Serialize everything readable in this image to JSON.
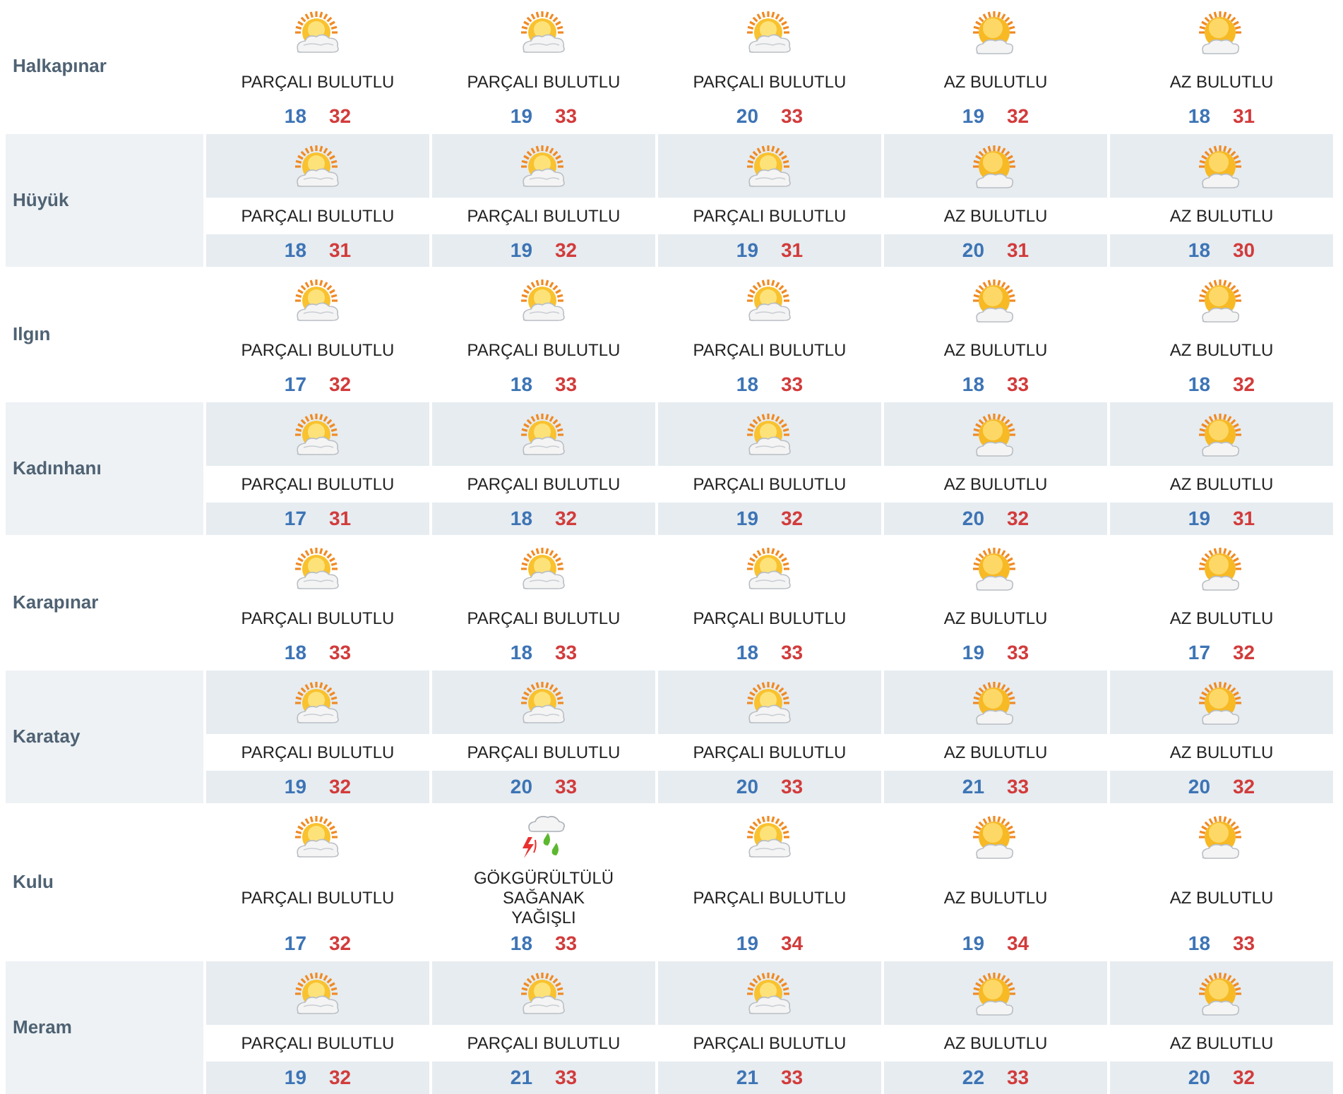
{
  "rows": [
    {
      "name": "Halkapınar",
      "forecasts": [
        {
          "kind": "partly_cloudy",
          "condition": "PARÇALI BULUTLU",
          "low": "18",
          "high": "32"
        },
        {
          "kind": "partly_cloudy",
          "condition": "PARÇALI BULUTLU",
          "low": "19",
          "high": "33"
        },
        {
          "kind": "partly_cloudy",
          "condition": "PARÇALI BULUTLU",
          "low": "20",
          "high": "33"
        },
        {
          "kind": "mostly_sunny",
          "condition": "AZ BULUTLU",
          "low": "19",
          "high": "32"
        },
        {
          "kind": "mostly_sunny",
          "condition": "AZ BULUTLU",
          "low": "18",
          "high": "31"
        }
      ]
    },
    {
      "name": "Hüyük",
      "forecasts": [
        {
          "kind": "partly_cloudy",
          "condition": "PARÇALI BULUTLU",
          "low": "18",
          "high": "31"
        },
        {
          "kind": "partly_cloudy",
          "condition": "PARÇALI BULUTLU",
          "low": "19",
          "high": "32"
        },
        {
          "kind": "partly_cloudy",
          "condition": "PARÇALI BULUTLU",
          "low": "19",
          "high": "31"
        },
        {
          "kind": "mostly_sunny",
          "condition": "AZ BULUTLU",
          "low": "20",
          "high": "31"
        },
        {
          "kind": "mostly_sunny",
          "condition": "AZ BULUTLU",
          "low": "18",
          "high": "30"
        }
      ]
    },
    {
      "name": "Ilgın",
      "forecasts": [
        {
          "kind": "partly_cloudy",
          "condition": "PARÇALI BULUTLU",
          "low": "17",
          "high": "32"
        },
        {
          "kind": "partly_cloudy",
          "condition": "PARÇALI BULUTLU",
          "low": "18",
          "high": "33"
        },
        {
          "kind": "partly_cloudy",
          "condition": "PARÇALI BULUTLU",
          "low": "18",
          "high": "33"
        },
        {
          "kind": "mostly_sunny",
          "condition": "AZ BULUTLU",
          "low": "18",
          "high": "33"
        },
        {
          "kind": "mostly_sunny",
          "condition": "AZ BULUTLU",
          "low": "18",
          "high": "32"
        }
      ]
    },
    {
      "name": "Kadınhanı",
      "forecasts": [
        {
          "kind": "partly_cloudy",
          "condition": "PARÇALI BULUTLU",
          "low": "17",
          "high": "31"
        },
        {
          "kind": "partly_cloudy",
          "condition": "PARÇALI BULUTLU",
          "low": "18",
          "high": "32"
        },
        {
          "kind": "partly_cloudy",
          "condition": "PARÇALI BULUTLU",
          "low": "19",
          "high": "32"
        },
        {
          "kind": "mostly_sunny",
          "condition": "AZ BULUTLU",
          "low": "20",
          "high": "32"
        },
        {
          "kind": "mostly_sunny",
          "condition": "AZ BULUTLU",
          "low": "19",
          "high": "31"
        }
      ]
    },
    {
      "name": "Karapınar",
      "forecasts": [
        {
          "kind": "partly_cloudy",
          "condition": "PARÇALI BULUTLU",
          "low": "18",
          "high": "33"
        },
        {
          "kind": "partly_cloudy",
          "condition": "PARÇALI BULUTLU",
          "low": "18",
          "high": "33"
        },
        {
          "kind": "partly_cloudy",
          "condition": "PARÇALI BULUTLU",
          "low": "18",
          "high": "33"
        },
        {
          "kind": "mostly_sunny",
          "condition": "AZ BULUTLU",
          "low": "19",
          "high": "33"
        },
        {
          "kind": "mostly_sunny",
          "condition": "AZ BULUTLU",
          "low": "17",
          "high": "32"
        }
      ]
    },
    {
      "name": "Karatay",
      "forecasts": [
        {
          "kind": "partly_cloudy",
          "condition": "PARÇALI BULUTLU",
          "low": "19",
          "high": "32"
        },
        {
          "kind": "partly_cloudy",
          "condition": "PARÇALI BULUTLU",
          "low": "20",
          "high": "33"
        },
        {
          "kind": "partly_cloudy",
          "condition": "PARÇALI BULUTLU",
          "low": "20",
          "high": "33"
        },
        {
          "kind": "mostly_sunny",
          "condition": "AZ BULUTLU",
          "low": "21",
          "high": "33"
        },
        {
          "kind": "mostly_sunny",
          "condition": "AZ BULUTLU",
          "low": "20",
          "high": "32"
        }
      ]
    },
    {
      "name": "Kulu",
      "forecasts": [
        {
          "kind": "partly_cloudy",
          "condition": "PARÇALI BULUTLU",
          "low": "17",
          "high": "32"
        },
        {
          "kind": "thunderstorm",
          "condition": "GÖKGÜRÜLTÜLÜ SAĞANAK YAĞIŞLI",
          "low": "18",
          "high": "33"
        },
        {
          "kind": "partly_cloudy",
          "condition": "PARÇALI BULUTLU",
          "low": "19",
          "high": "34"
        },
        {
          "kind": "mostly_sunny",
          "condition": "AZ BULUTLU",
          "low": "19",
          "high": "34"
        },
        {
          "kind": "mostly_sunny",
          "condition": "AZ BULUTLU",
          "low": "18",
          "high": "33"
        }
      ]
    },
    {
      "name": "Meram",
      "forecasts": [
        {
          "kind": "partly_cloudy",
          "condition": "PARÇALI BULUTLU",
          "low": "19",
          "high": "32"
        },
        {
          "kind": "partly_cloudy",
          "condition": "PARÇALI BULUTLU",
          "low": "21",
          "high": "33"
        },
        {
          "kind": "partly_cloudy",
          "condition": "PARÇALI BULUTLU",
          "low": "21",
          "high": "33"
        },
        {
          "kind": "mostly_sunny",
          "condition": "AZ BULUTLU",
          "low": "22",
          "high": "33"
        },
        {
          "kind": "mostly_sunny",
          "condition": "AZ BULUTLU",
          "low": "20",
          "high": "32"
        }
      ]
    }
  ]
}
